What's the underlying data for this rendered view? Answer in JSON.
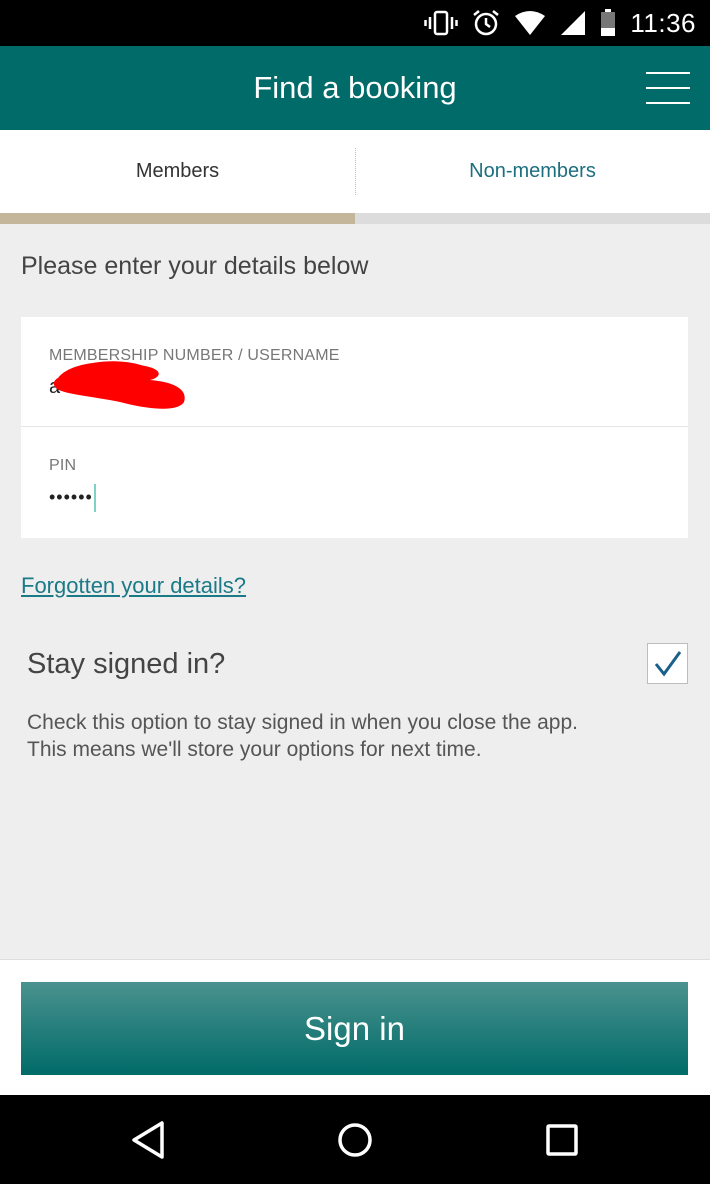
{
  "status_bar": {
    "time": "11:36",
    "icons": [
      "vibrate-icon",
      "alarm-icon",
      "wifi-icon",
      "signal-icon",
      "battery-icon"
    ]
  },
  "app_bar": {
    "title": "Find a booking",
    "menu_icon": "hamburger-menu-icon"
  },
  "tabs": [
    {
      "label": "Members",
      "selected": true
    },
    {
      "label": "Non-members",
      "selected": false
    }
  ],
  "form": {
    "intro": "Please enter your details below",
    "username": {
      "label": "MEMBERSHIP NUMBER / USERNAME",
      "value": "a",
      "redacted": true
    },
    "pin": {
      "label": "PIN",
      "value": "••••••"
    },
    "forgot_link": "Forgotten your details?",
    "stay_signed_in": {
      "label": "Stay signed in?",
      "checked": true,
      "help": "Check this option to stay signed in when you close the app. This means we'll store your options for next time."
    }
  },
  "footer": {
    "sign_in_label": "Sign in"
  },
  "colors": {
    "brand_teal": "#006b68",
    "tab_indicator": "#c4b69b",
    "link": "#1a7a87"
  },
  "nav_bar": {
    "icons": [
      "back-icon",
      "home-icon",
      "recents-icon"
    ]
  }
}
